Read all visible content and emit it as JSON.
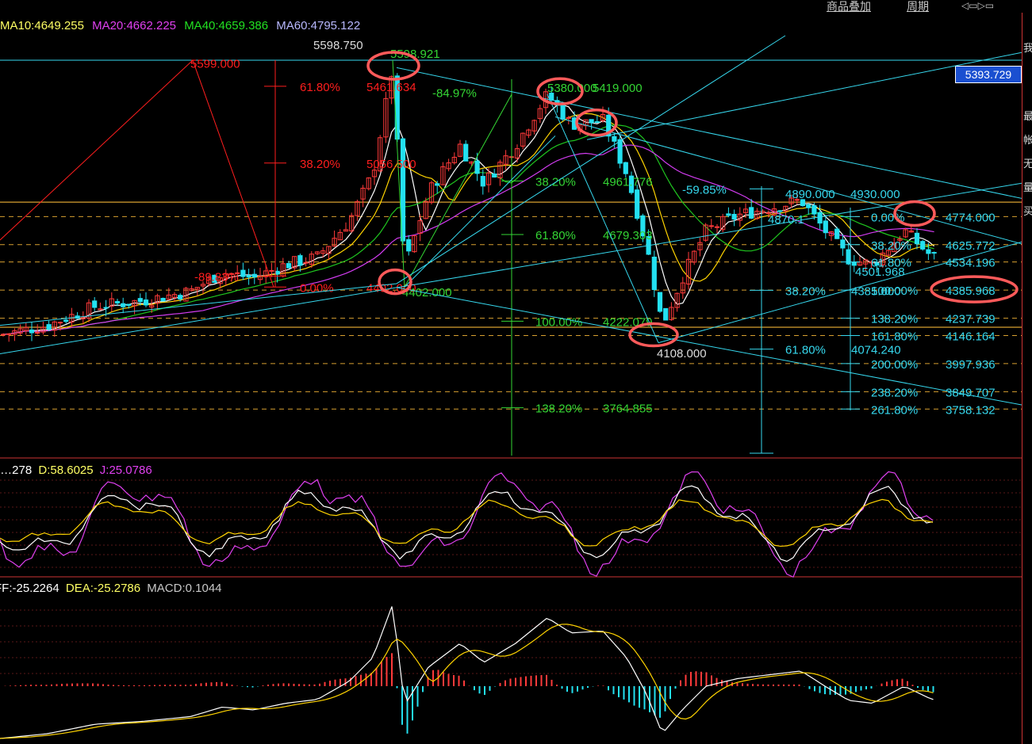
{
  "toolbar": {
    "overlay": "商品叠加",
    "period": "周期"
  },
  "price_tag": "5393.729",
  "right_strip_chars": [
    "我",
    "最",
    "帐",
    "无",
    "量",
    "买"
  ],
  "colors": {
    "up": "#ff3a3a",
    "down": "#23e0f0",
    "ma10": "#ffffff",
    "ma20": "#ffd400",
    "ma40": "#1fc61f",
    "ma60": "#d23cf0",
    "fib_red": "#ff1e1e",
    "fib_green": "#34d634",
    "fib_cyan": "#36d8ee",
    "dash": "#d8a030"
  },
  "chart_data": [
    {
      "type": "candlestick",
      "ylim": [
        3500,
        5850
      ],
      "legend": [
        {
          "text": "MA10:4649.255",
          "color": "#ffff64"
        },
        {
          "text": "MA20:4662.225",
          "color": "#e040f0"
        },
        {
          "text": "MA40:4659.386",
          "color": "#22e022"
        },
        {
          "text": "MA60:4795.122",
          "color": "#b8b8ff"
        }
      ],
      "extreme_labels": [
        "5598.750",
        "5599.000",
        "5598.921"
      ],
      "fib_red": [
        {
          "pct": "61.80%",
          "price": "5461.634",
          "value": 5461.634
        },
        {
          "pct": "38.20%",
          "price": "5056.500",
          "value": 5056.5
        },
        {
          "pct": "0.00%",
          "price": "4402.000",
          "value": 4402.0
        },
        {
          "pct": "-89.83%",
          "price": "",
          "value": 4460
        }
      ],
      "fib_green": [
        {
          "pct": "-84.97%",
          "price": "",
          "value": 5430
        },
        {
          "pct": "38.20%",
          "price": "4961.776",
          "value": 4961.776
        },
        {
          "pct": "61.80%",
          "price": "4679.303",
          "value": 4679.303
        },
        {
          "pct": "100.00%",
          "price": "4222.079",
          "value": 4222.079
        },
        {
          "pct": "138.20%",
          "price": "3764.855",
          "value": 3764.855
        }
      ],
      "fib_green_labels": [
        "5380.000",
        "5419.000",
        "4402.000",
        "4108.000"
      ],
      "fib_cyan_left": [
        {
          "pct": "-59.85%",
          "price": "",
          "value": 4920
        },
        {
          "pct": "38.20%",
          "price": "4385.000",
          "value": 4385.0
        },
        {
          "pct": "61.80%",
          "price": "4074.240",
          "value": 4074.24
        }
      ],
      "fib_cyan_right": [
        {
          "pct": "0.00%",
          "price": "4774.000",
          "value": 4774.0
        },
        {
          "pct": "38.20%",
          "price": "4625.772",
          "value": 4625.772
        },
        {
          "pct": "61.80%",
          "price": "4534.196",
          "value": 4534.196
        },
        {
          "pct": "100.00%",
          "price": "4385.968",
          "value": 4385.968
        },
        {
          "pct": "138.20%",
          "price": "4237.739",
          "value": 4237.739
        },
        {
          "pct": "161.80%",
          "price": "4146.164",
          "value": 4146.164
        },
        {
          "pct": "200.00%",
          "price": "3997.936",
          "value": 3997.936
        },
        {
          "pct": "238.20%",
          "price": "3849.707",
          "value": 3849.707
        },
        {
          "pct": "261.80%",
          "price": "3758.132",
          "value": 3758.132
        }
      ],
      "cyan_misc_labels": [
        "4501.968",
        "4890.000",
        "4930.000",
        "4870.1"
      ],
      "circled_prices": [
        "5598.921",
        "5419.000",
        "4402.000",
        "4108.000",
        "4774.000",
        "4385.968"
      ]
    },
    {
      "type": "line",
      "legend": [
        {
          "text": "K:…278",
          "color": "#ffffff"
        },
        {
          "text": "D:58.6025",
          "color": "#ffff64"
        },
        {
          "text": "J:25.0786",
          "color": "#e040f0"
        }
      ]
    },
    {
      "type": "bar",
      "legend": [
        {
          "text": "DIFF:-25.2264",
          "color": "#ffffff"
        },
        {
          "text": "DEA:-25.2786",
          "color": "#ffff64"
        },
        {
          "text": "MACD:0.1044",
          "color": "#c8c8c8"
        }
      ]
    }
  ]
}
